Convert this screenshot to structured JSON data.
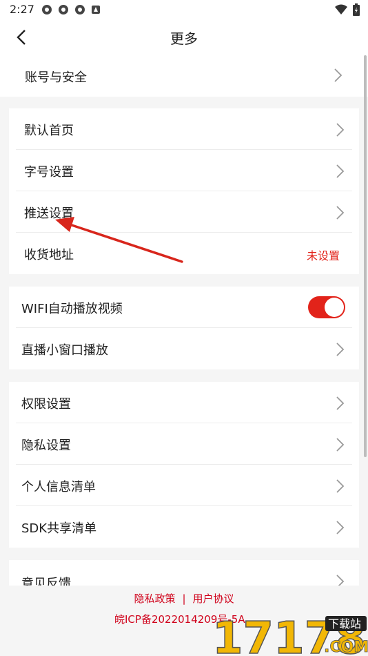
{
  "status": {
    "time": "2:27"
  },
  "header": {
    "title": "更多"
  },
  "sections": {
    "account": {
      "label": "账号与安全"
    },
    "general": [
      {
        "label": "默认首页"
      },
      {
        "label": "字号设置"
      },
      {
        "label": "推送设置"
      },
      {
        "label": "收货地址",
        "value": "未设置"
      }
    ],
    "video": {
      "wifi_autoplay": {
        "label": "WIFI自动播放视频",
        "enabled": true
      },
      "pip": {
        "label": "直播小窗口播放"
      }
    },
    "privacy": [
      {
        "label": "权限设置"
      },
      {
        "label": "隐私设置"
      },
      {
        "label": "个人信息清单"
      },
      {
        "label": "SDK共享清单"
      }
    ],
    "feedback": {
      "label": "意见反馈"
    }
  },
  "footer": {
    "privacy_policy": "隐私政策",
    "separator": "|",
    "user_agreement": "用户协议",
    "icp": "皖ICP备2022014209号-5A"
  },
  "watermark": {
    "number": "17178",
    "domain": ".COM",
    "tag": "下载站"
  },
  "colors": {
    "accent": "#e2231a",
    "background": "#f5f5f5"
  }
}
